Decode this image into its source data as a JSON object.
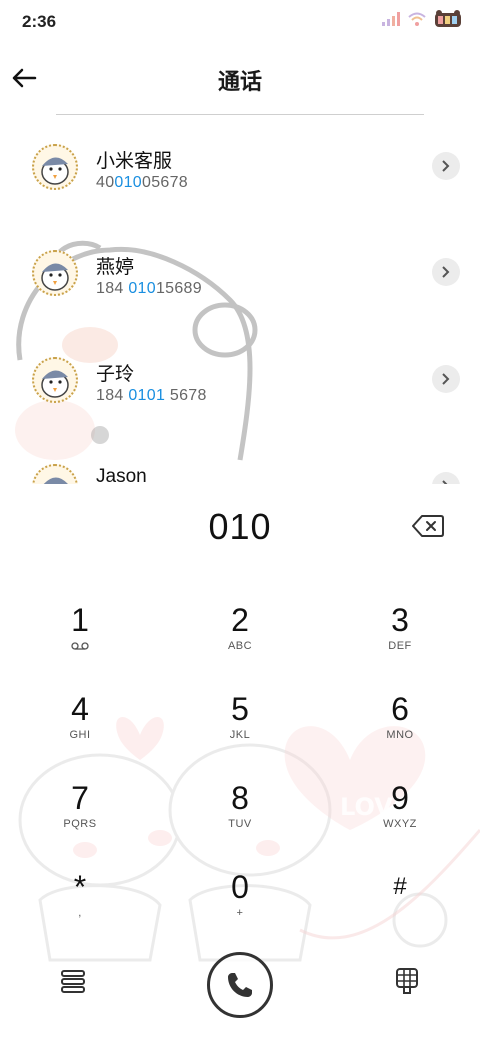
{
  "status_bar": {
    "time": "2:36"
  },
  "header": {
    "title": "通话"
  },
  "contacts": [
    {
      "name": "小米客服",
      "number_pre": "40",
      "number_hl": "010",
      "number_post": "05678"
    },
    {
      "name": "燕婷",
      "number_pre": "184 ",
      "number_hl": "010",
      "number_post": "15689"
    },
    {
      "name": "子玲",
      "number_pre": "184 ",
      "number_hl": "0101",
      "number_post": " 5678"
    },
    {
      "name": "Jason",
      "number_pre": "",
      "number_hl": "",
      "number_post": ""
    }
  ],
  "dialer": {
    "input": "010",
    "keys": [
      {
        "digit": "1",
        "sub": ""
      },
      {
        "digit": "2",
        "sub": "ABC"
      },
      {
        "digit": "3",
        "sub": "DEF"
      },
      {
        "digit": "4",
        "sub": "GHI"
      },
      {
        "digit": "5",
        "sub": "JKL"
      },
      {
        "digit": "6",
        "sub": "MNO"
      },
      {
        "digit": "7",
        "sub": "PQRS"
      },
      {
        "digit": "8",
        "sub": "TUV"
      },
      {
        "digit": "9",
        "sub": "WXYZ"
      },
      {
        "digit": "*",
        "sub": ","
      },
      {
        "digit": "0",
        "sub": "+"
      },
      {
        "digit": "#",
        "sub": ""
      }
    ],
    "wallpaper_text": "LOVE"
  },
  "colors": {
    "accent": "#1a8fe0",
    "text": "#111111",
    "muted": "#666666"
  },
  "icons": {
    "back": "arrow-left-icon",
    "backspace": "backspace-icon",
    "call": "phone-icon",
    "menu": "menu-icon",
    "keypad": "keypad-icon",
    "voicemail": "voicemail-icon",
    "chevron": "chevron-right-icon"
  }
}
